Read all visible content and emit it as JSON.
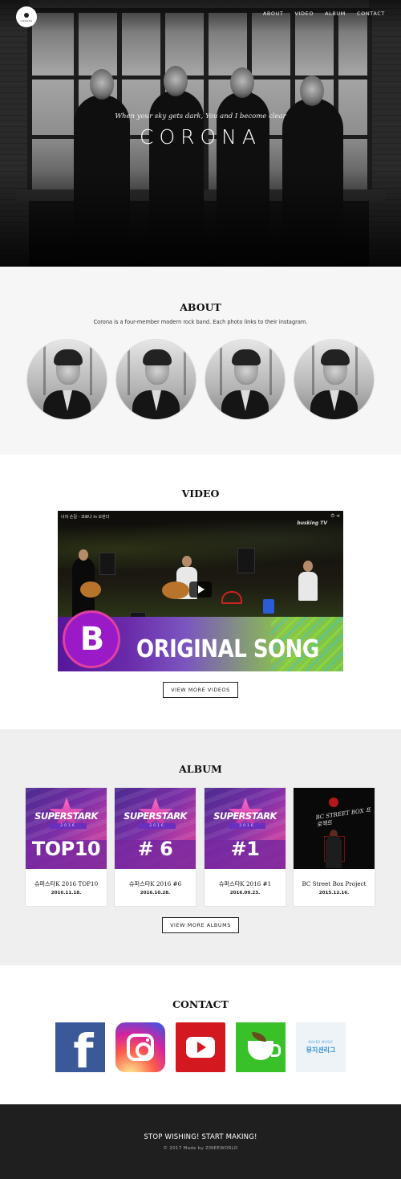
{
  "header": {
    "logo_text": "CORONA",
    "nav": [
      "ABOUT",
      "VIDEO",
      "ALBUM",
      "CONTACT"
    ]
  },
  "hero": {
    "tagline": "When your sky gets dark, You and I become clear",
    "title": "CORONA"
  },
  "about": {
    "title": "ABOUT",
    "description": "Corona is a four-member modern rock band. Each photo links to their instagram."
  },
  "video": {
    "title": "VIDEO",
    "player_title": "너의 손길 - 코로나 in 오란다",
    "channel": "busking TV",
    "overlay_logo": "B",
    "overlay_text": "ORIGINAL SONG",
    "button": "VIEW MORE VIDEOS"
  },
  "album": {
    "title": "ALBUM",
    "cards": [
      {
        "cover_brand": "SUPERSTARK",
        "cover_year": "2016",
        "cover_rank": "TOP10",
        "title": "슈퍼스타K 2016 TOP10",
        "date": "2016.11.18."
      },
      {
        "cover_brand": "SUPERSTARK",
        "cover_year": "2016",
        "cover_rank": "# 6",
        "title": "슈퍼스타K 2016 #6",
        "date": "2016.10.28."
      },
      {
        "cover_brand": "SUPERSTARK",
        "cover_year": "2016",
        "cover_rank": "#1",
        "title": "슈퍼스타K 2016 #1",
        "date": "2016.09.23."
      },
      {
        "cover_text": "BC STREET BOX 프로젝트",
        "title": "BC Street Box Project",
        "date": "2015.12.16."
      }
    ],
    "button": "VIEW MORE ALBUMS"
  },
  "contact": {
    "title": "CONTACT",
    "naver_small": "NAVER MUSIC",
    "naver_large": "뮤지션리그"
  },
  "footer": {
    "slogan": "STOP WISHING! START MAKING!",
    "copyright": "© 2017 Made by ZINEEWORLD"
  }
}
